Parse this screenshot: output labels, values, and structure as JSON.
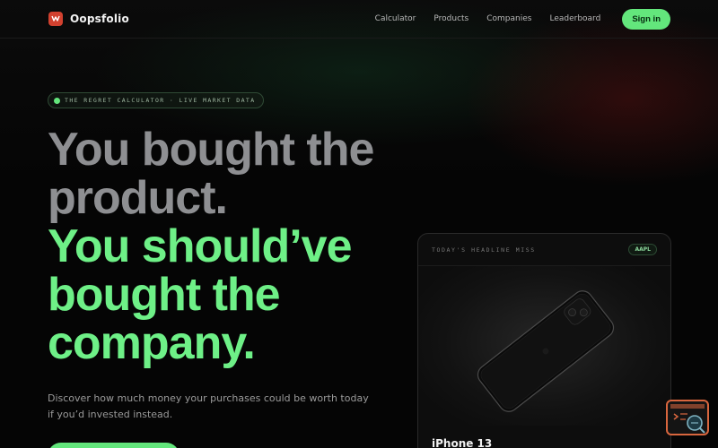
{
  "nav": {
    "brand": "Oopsfolio",
    "links": [
      "Calculator",
      "Products",
      "Companies",
      "Leaderboard"
    ],
    "signin_label": "Sign in"
  },
  "badge": {
    "text": "THE REGRET CALCULATOR · LIVE MARKET DATA"
  },
  "hero": {
    "line1": "You bought the",
    "line2": "product.",
    "line3": "You should’ve",
    "line4": "bought the",
    "line5": "company.",
    "subtitle_line1": "Discover how much money your purchases could be worth today",
    "subtitle_line2": "if you’d invested instead."
  },
  "card": {
    "label": "TODAY'S HEADLINE MISS",
    "ticker": "AAPL",
    "product_name": "iPhone 13"
  },
  "colors": {
    "accent": "#63e67c",
    "headline_grey": "#8e8f92",
    "headline_green": "#6ef087",
    "logo": "#d2412f",
    "widget_border": "#d8663e"
  },
  "icons": {
    "logo": "oopsfolio-logo-icon",
    "badge_dot": "live-dot-icon",
    "product_image": "iphone-image",
    "widget": "terminal-search-icon"
  }
}
